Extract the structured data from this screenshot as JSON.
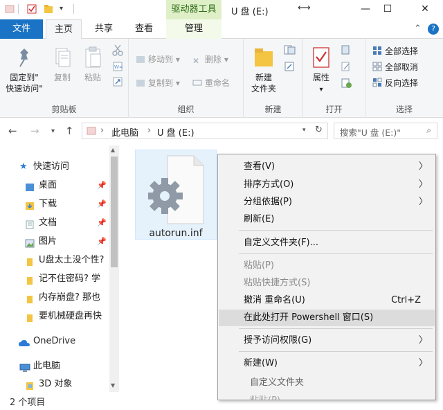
{
  "title_bar": {
    "context_tab_label": "驱动器工具",
    "window_title": "U 盘 (E:)",
    "min_icon": "minimize-icon",
    "max_icon": "maximize-icon",
    "close_icon": "close-icon"
  },
  "ribbon_tabs": {
    "file": "文件",
    "home": "主页",
    "share": "共享",
    "view": "查看",
    "manage": "管理"
  },
  "ribbon": {
    "clipboard": {
      "label": "剪贴板",
      "pin_line1": "固定到\"",
      "pin_line2": "快速访问\"",
      "copy": "复制",
      "paste": "粘贴"
    },
    "organize": {
      "label": "组织",
      "move_to": "移动到",
      "copy_to": "复制到",
      "delete": "删除",
      "rename": "重命名"
    },
    "new": {
      "label": "新建",
      "new_folder_line1": "新建",
      "new_folder_line2": "文件夹"
    },
    "open": {
      "label": "打开",
      "properties": "属性"
    },
    "select": {
      "label": "选择",
      "select_all": "全部选择",
      "select_none": "全部取消",
      "invert": "反向选择"
    }
  },
  "address": {
    "crumb_pc": "此电脑",
    "crumb_drive": "U 盘 (E:)",
    "search_placeholder": "搜索\"U 盘 (E:)\""
  },
  "nav_pane": {
    "quick_access": "快速访问",
    "items": [
      {
        "label": "桌面",
        "pinned": true
      },
      {
        "label": "下载",
        "pinned": true
      },
      {
        "label": "文档",
        "pinned": true
      },
      {
        "label": "图片",
        "pinned": true
      },
      {
        "label": "U盘太土没个性?",
        "pinned": false
      },
      {
        "label": "记不住密码? 学",
        "pinned": false
      },
      {
        "label": "内存崩盘? 那也",
        "pinned": false
      },
      {
        "label": "要机械硬盘再快",
        "pinned": false
      }
    ],
    "onedrive": "OneDrive",
    "this_pc": "此电脑",
    "objects_3d": "3D 对象"
  },
  "content": {
    "file_name": "autorun.inf"
  },
  "status": {
    "item_count": "2 个项目"
  },
  "context_menu": {
    "items": [
      {
        "label": "查看(V)",
        "submenu": true,
        "disabled": false
      },
      {
        "label": "排序方式(O)",
        "submenu": true,
        "disabled": false
      },
      {
        "label": "分组依据(P)",
        "submenu": true,
        "disabled": false
      },
      {
        "label": "刷新(E)",
        "submenu": false,
        "disabled": false
      },
      {
        "label": "自定义文件夹(F)...",
        "submenu": false,
        "disabled": false
      },
      {
        "label": "粘贴(P)",
        "submenu": false,
        "disabled": true
      },
      {
        "label": "粘贴快捷方式(S)",
        "submenu": false,
        "disabled": true
      },
      {
        "label": "撤消 重命名(U)",
        "submenu": false,
        "disabled": false,
        "shortcut": "Ctrl+Z"
      },
      {
        "label": "在此处打开 Powershell 窗口(S)",
        "submenu": false,
        "disabled": false,
        "highlighted": true
      },
      {
        "label": "授予访问权限(G)",
        "submenu": true,
        "disabled": false
      },
      {
        "label": "新建(W)",
        "submenu": true,
        "disabled": false
      }
    ],
    "ghost_item": "自定义文件夹",
    "ghost_paste": "粘贴(P)"
  }
}
